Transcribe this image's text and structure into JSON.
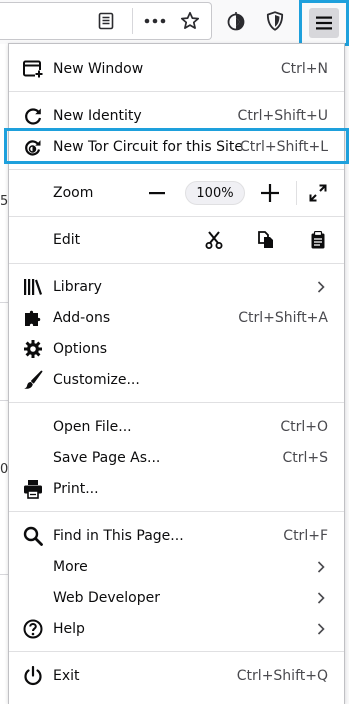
{
  "toolbar": {
    "icons": [
      "reader-view-icon",
      "page-actions-icon",
      "bookmark-star-icon",
      "tor-onion-icon",
      "shield-icon",
      "hamburger-menu-icon"
    ]
  },
  "page_behind": {
    "fragments": [
      "5",
      "0"
    ]
  },
  "menu": {
    "new_window": {
      "label": "New Window",
      "shortcut": "Ctrl+N"
    },
    "new_identity": {
      "label": "New Identity",
      "shortcut": "Ctrl+Shift+U"
    },
    "new_tor_circuit": {
      "label": "New Tor Circuit for this Site",
      "shortcut": "Ctrl+Shift+L"
    },
    "zoom": {
      "label": "Zoom",
      "minus": "−",
      "value": "100%",
      "plus": "+"
    },
    "edit": {
      "label": "Edit"
    },
    "library": {
      "label": "Library"
    },
    "addons": {
      "label": "Add-ons",
      "shortcut": "Ctrl+Shift+A"
    },
    "options": {
      "label": "Options"
    },
    "customize": {
      "label": "Customize..."
    },
    "open_file": {
      "label": "Open File...",
      "shortcut": "Ctrl+O"
    },
    "save_page": {
      "label": "Save Page As...",
      "shortcut": "Ctrl+S"
    },
    "print": {
      "label": "Print..."
    },
    "find": {
      "label": "Find in This Page...",
      "shortcut": "Ctrl+F"
    },
    "more": {
      "label": "More"
    },
    "web_developer": {
      "label": "Web Developer"
    },
    "help": {
      "label": "Help"
    },
    "exit": {
      "label": "Exit",
      "shortcut": "Ctrl+Shift+Q"
    }
  },
  "colors": {
    "highlight": "#1ea0dc",
    "panel_bg": "#ffffff",
    "toolbar_bg": "#f9f9fa",
    "text": "#0c0c0d"
  }
}
